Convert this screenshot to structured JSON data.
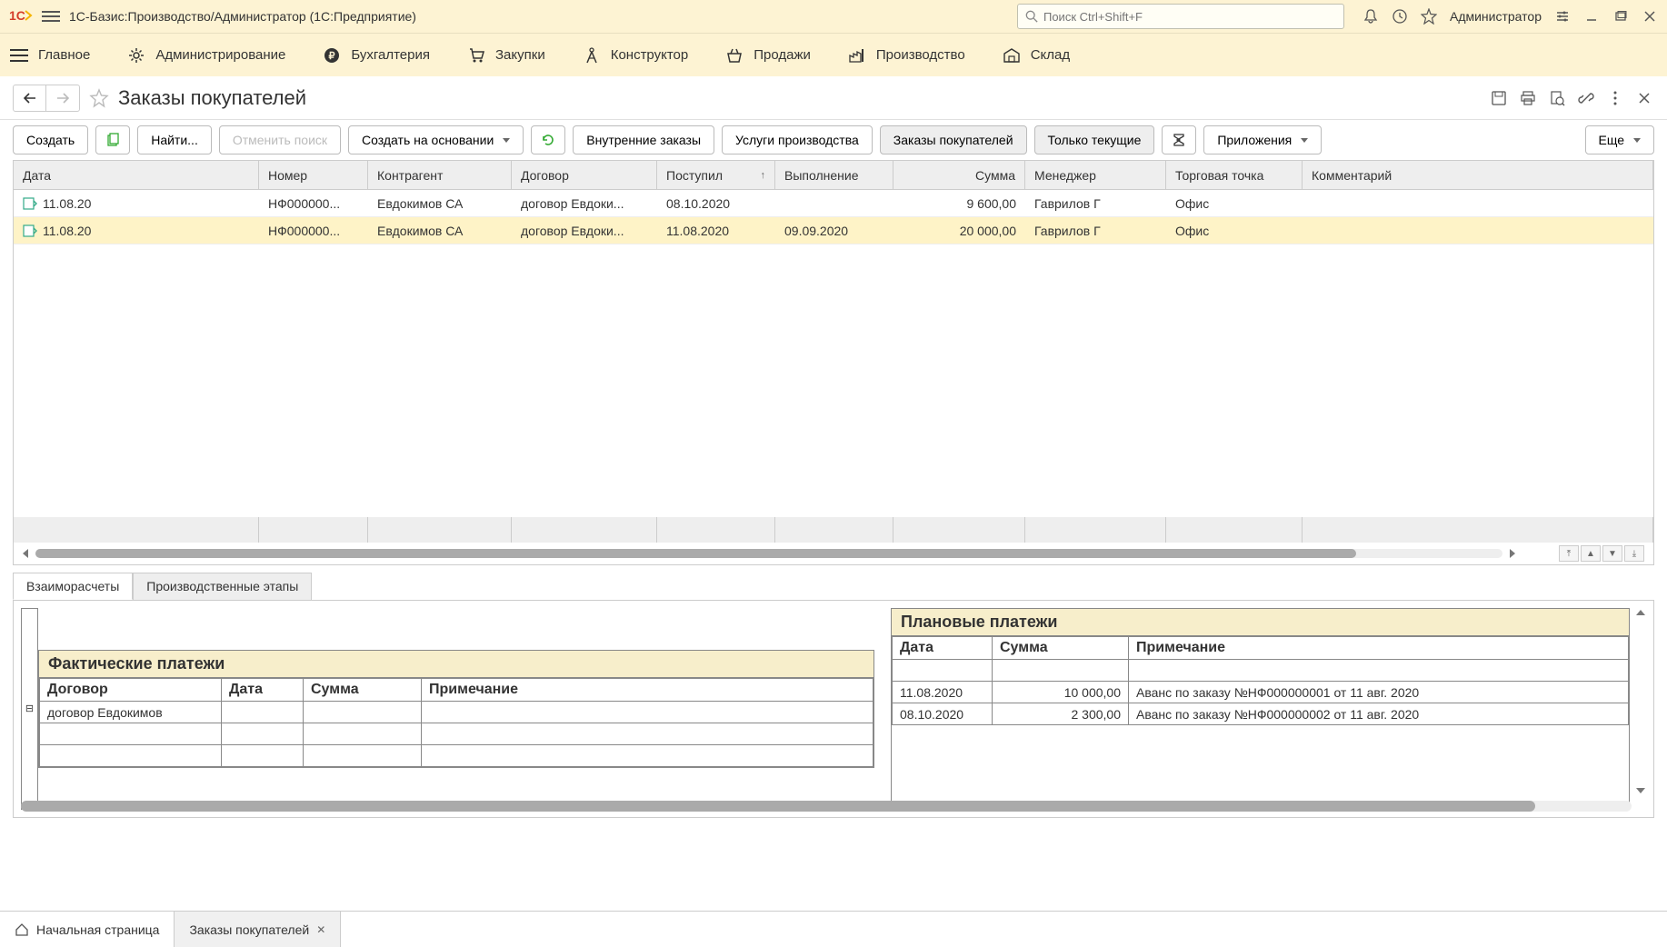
{
  "title": "1С-Базис:Производство/Администратор  (1С:Предприятие)",
  "search": {
    "placeholder": "Поиск Ctrl+Shift+F"
  },
  "user": "Администратор",
  "nav": {
    "main": "Главное",
    "admin": "Администрирование",
    "accounting": "Бухгалтерия",
    "purchasing": "Закупки",
    "constructor": "Конструктор",
    "sales": "Продажи",
    "production": "Производство",
    "warehouse": "Склад"
  },
  "page": {
    "title": "Заказы покупателей"
  },
  "toolbar": {
    "create": "Создать",
    "find": "Найти...",
    "cancel_search": "Отменить поиск",
    "create_based_on": "Создать на основании",
    "internal_orders": "Внутренние заказы",
    "production_services": "Услуги производства",
    "buyer_orders": "Заказы покупателей",
    "only_current": "Только текущие",
    "attachments": "Приложения",
    "more": "Еще"
  },
  "columns": {
    "date": "Дата",
    "number": "Номер",
    "counterparty": "Контрагент",
    "contract": "Договор",
    "received": "Поступил",
    "completion": "Выполнение",
    "amount": "Сумма",
    "manager": "Менеджер",
    "shop": "Торговая точка",
    "comment": "Комментарий"
  },
  "rows": [
    {
      "date": "11.08.20",
      "number": "НФ000000...",
      "counterparty": "Евдокимов СА",
      "contract": "договор Евдоки...",
      "received": "08.10.2020",
      "completion": "",
      "amount": "9 600,00",
      "manager": "Гаврилов Г",
      "shop": "Офис",
      "comment": "",
      "selected": false
    },
    {
      "date": "11.08.20",
      "number": "НФ000000...",
      "counterparty": "Евдокимов СА",
      "contract": "договор Евдоки...",
      "received": "11.08.2020",
      "completion": "09.09.2020",
      "amount": "20 000,00",
      "manager": "Гаврилов Г",
      "shop": "Офис",
      "comment": "",
      "selected": true
    }
  ],
  "bottom_tabs": {
    "mutual": "Взаиморасчеты",
    "stages": "Производственные этапы"
  },
  "actual_payments": {
    "title": "Фактические платежи",
    "headers": {
      "contract": "Договор",
      "date": "Дата",
      "amount": "Сумма",
      "note": "Примечание"
    },
    "rows": [
      {
        "contract": "договор Евдокимов",
        "date": "",
        "amount": "",
        "note": ""
      }
    ]
  },
  "planned_payments": {
    "title": "Плановые платежи",
    "headers": {
      "date": "Дата",
      "amount": "Сумма",
      "note": "Примечание"
    },
    "rows": [
      {
        "date": "11.08.2020",
        "amount": "10 000,00",
        "note": "Аванс по заказу №НФ000000001 от 11 авг. 2020"
      },
      {
        "date": "08.10.2020",
        "amount": "2 300,00",
        "note": "Аванс по заказу №НФ000000002 от 11 авг. 2020"
      }
    ]
  },
  "window_tabs": {
    "home": "Начальная страница",
    "orders": "Заказы покупателей"
  }
}
